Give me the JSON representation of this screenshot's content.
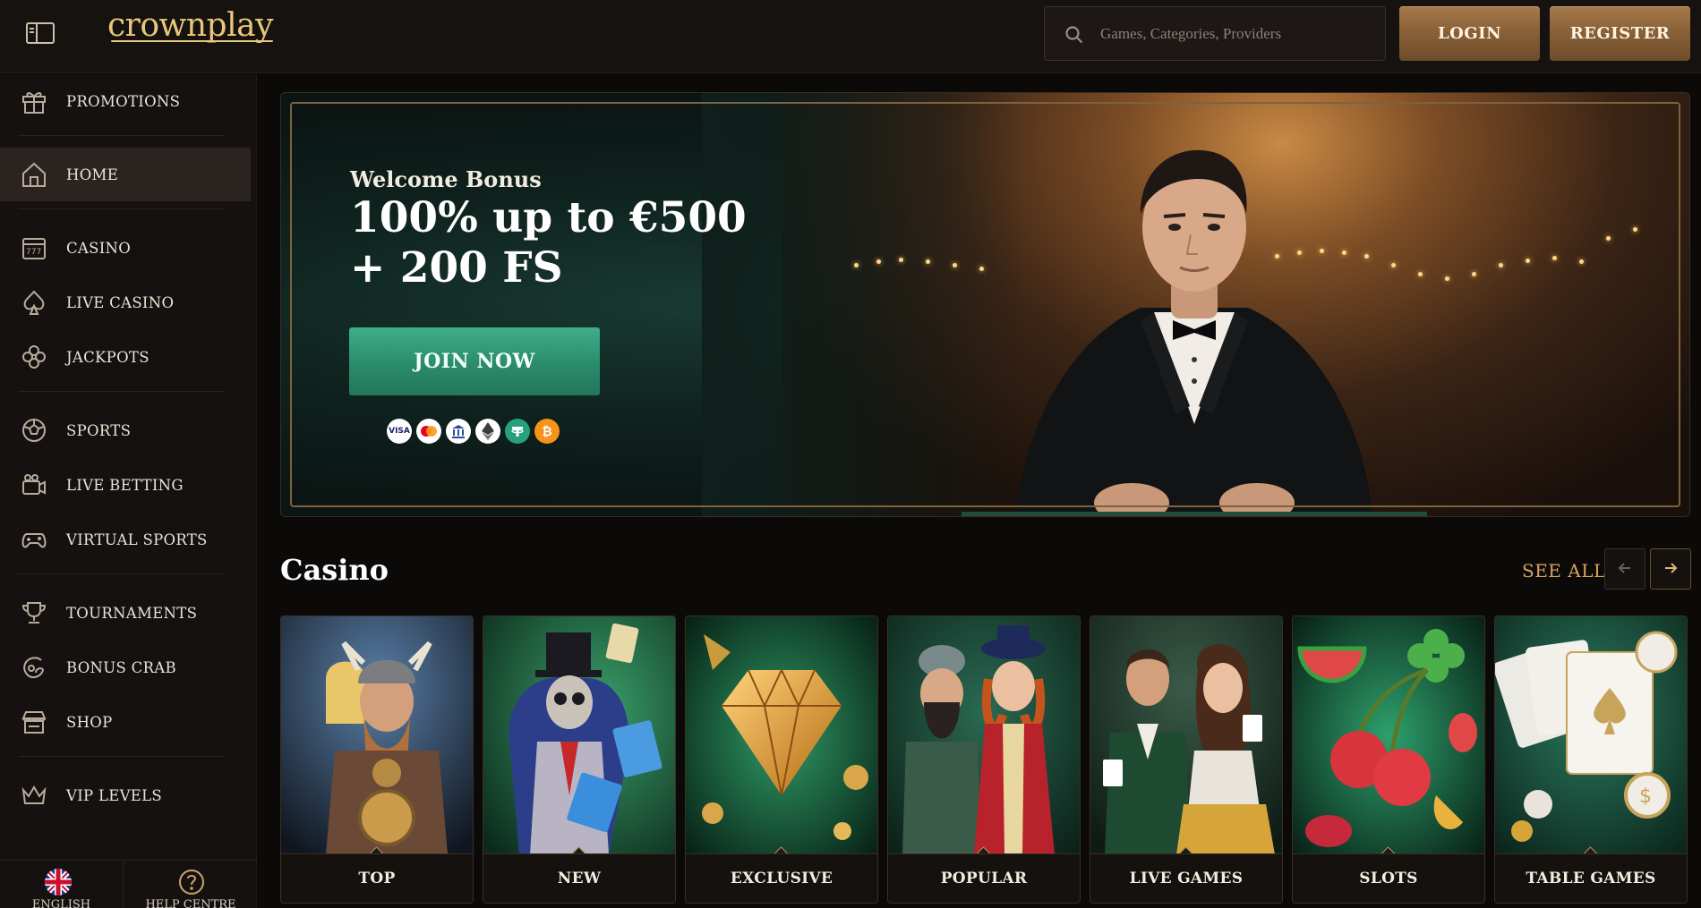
{
  "header": {
    "logo": "crownplay",
    "search_placeholder": "Games, Categories, Providers",
    "login_label": "LOGIN",
    "register_label": "REGISTER"
  },
  "sidebar": {
    "items": [
      {
        "label": "PROMOTIONS",
        "icon": "gift-icon"
      },
      {
        "label": "HOME",
        "icon": "home-icon",
        "active": true
      },
      {
        "label": "CASINO",
        "icon": "slot-machine-icon"
      },
      {
        "label": "LIVE CASINO",
        "icon": "spade-icon"
      },
      {
        "label": "JACKPOTS",
        "icon": "clover-icon"
      },
      {
        "label": "SPORTS",
        "icon": "soccer-ball-icon"
      },
      {
        "label": "LIVE BETTING",
        "icon": "live-tv-icon"
      },
      {
        "label": "VIRTUAL SPORTS",
        "icon": "gamepad-icon"
      },
      {
        "label": "TOURNAMENTS",
        "icon": "trophy-icon"
      },
      {
        "label": "BONUS CRAB",
        "icon": "claw-icon"
      },
      {
        "label": "SHOP",
        "icon": "store-icon"
      },
      {
        "label": "VIP LEVELS",
        "icon": "crown-icon"
      }
    ],
    "language": "ENGLISH",
    "help": "HELP CENTRE"
  },
  "hero": {
    "tagline": "Welcome Bonus",
    "headline_line1": "100% up to €500",
    "headline_line2": "+ 200 FS",
    "cta": "JOIN NOW",
    "payments": [
      "visa-icon",
      "mastercard-icon",
      "bank-icon",
      "ethereum-icon",
      "tether-icon",
      "bitcoin-icon"
    ],
    "payment_labels": {
      "visa": "VISA",
      "bitcoin": "₿"
    }
  },
  "casino": {
    "title": "Casino",
    "see_all": "SEE ALL",
    "tiles": [
      {
        "label": "TOP",
        "accent": "#4a6a8a"
      },
      {
        "label": "NEW",
        "accent": "#2f7a4e"
      },
      {
        "label": "EXCLUSIVE",
        "accent": "#1f5e3e"
      },
      {
        "label": "POPULAR",
        "accent": "#1a4a3a"
      },
      {
        "label": "LIVE GAMES",
        "accent": "#2a4a3a"
      },
      {
        "label": "SLOTS",
        "accent": "#1d6a4a"
      },
      {
        "label": "TABLE GAMES",
        "accent": "#1a5a48"
      }
    ]
  },
  "colors": {
    "gold": "#d9a35c",
    "green_cta": "#2b8b6b",
    "bg": "#0c0a09"
  }
}
